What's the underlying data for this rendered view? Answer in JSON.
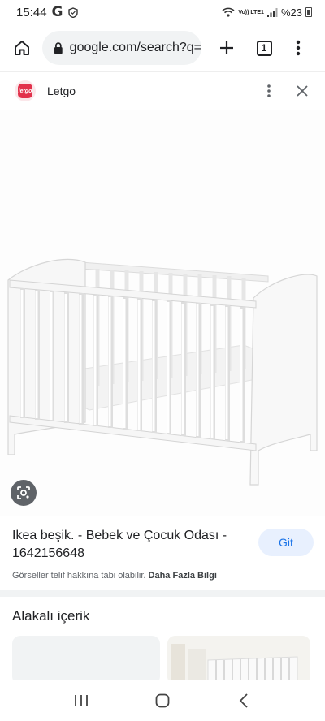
{
  "status": {
    "time": "15:44",
    "g_icon": "G",
    "volte": "Vo)) LTE1",
    "battery": "%23"
  },
  "browser": {
    "url": "google.com/search?q=",
    "tab_count": "1"
  },
  "panel": {
    "source_name": "Letgo",
    "logo_text": "letgo"
  },
  "result": {
    "title": "Ikea beşik. - Bebek ve Çocuk Odası - 1642156648",
    "go_label": "Git",
    "copyright_text": "Görseller telif hakkına tabi olabilir.",
    "more_info": "Daha Fazla Bilgi"
  },
  "related": {
    "heading": "Alakalı içerik"
  },
  "icons": {
    "home": "home-icon",
    "lock": "lock-icon",
    "add": "plus-icon",
    "menu": "more-vert-icon",
    "close": "close-icon",
    "lens": "lens-icon",
    "recents": "recents-icon",
    "nav_home": "nav-home-icon",
    "back": "back-icon"
  }
}
